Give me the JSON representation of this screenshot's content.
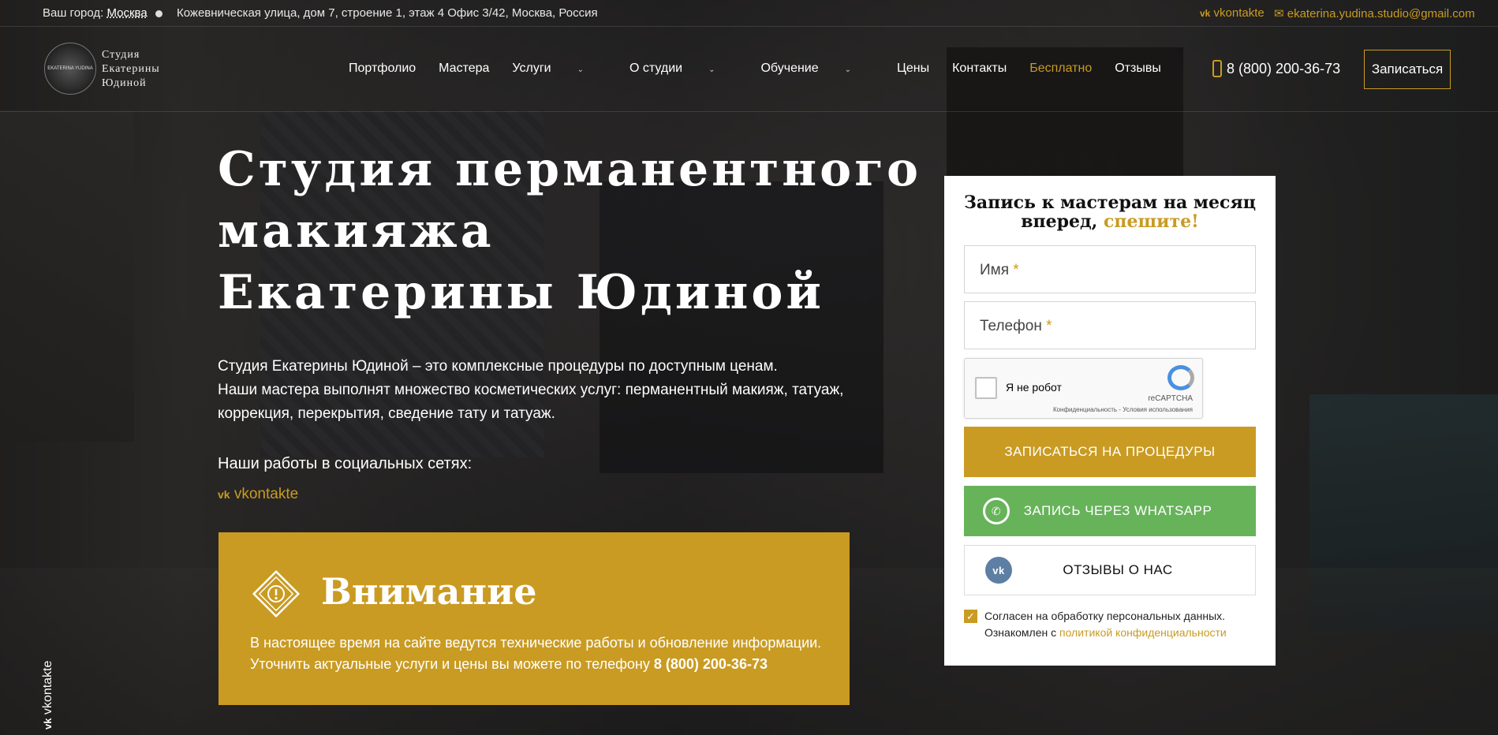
{
  "topbar": {
    "city_label": "Ваш город:",
    "city": "Москва",
    "address": "Кожевническая улица, дом 7, строение 1, этаж 4 Офис 3/42, Москва, Россия",
    "vk": "vkontakte",
    "email": "ekaterina.yudina.studio@gmail.com"
  },
  "header": {
    "logo_line1": "Студия",
    "logo_line2": "Екатерины",
    "logo_line3": "Юдиной",
    "logo_badge": "EKATERINA YUDINA",
    "nav": [
      {
        "label": "Портфолио"
      },
      {
        "label": "Мастера"
      },
      {
        "label": "Услуги"
      },
      {
        "label": "О студии"
      },
      {
        "label": "Обучение"
      },
      {
        "label": "Цены"
      },
      {
        "label": "Контакты"
      },
      {
        "label": "Бесплатно"
      },
      {
        "label": "Отзывы"
      }
    ],
    "phone": "8 (800) 200-36-73",
    "signup": "Записаться"
  },
  "hero": {
    "title_line1": "Студия перманентного",
    "title_line2": "макияжа",
    "title_line3": "Екатерины Юдиной",
    "desc_line1": "Студия Екатерины Юдиной – это комплексные процедуры по доступным ценам.",
    "desc_line2": "Наши мастера выполнят множество косметических услуг: перманентный макияж, татуаж,",
    "desc_line3": "коррекция, перекрытия, сведение тату и татуаж.",
    "social_title": "Наши работы в социальных сетях:",
    "social_vk": "vkontakte"
  },
  "notice": {
    "title": "Внимание",
    "line1": "В настоящее время на сайте ведутся технические работы и обновление информации.",
    "line2": "Уточнить актуальные услуги и цены вы можете по телефону",
    "phone": "8 (800) 200-36-73"
  },
  "form": {
    "title_main": "Запись к мастерам на месяц вперед,",
    "title_accent": "спешите!",
    "name_placeholder": "Имя",
    "phone_placeholder": "Телефон",
    "required_mark": "*",
    "captcha_label": "Я не робот",
    "captcha_brand": "reCAPTCHA",
    "captcha_terms": "Конфиденциальность - Условия использования",
    "btn_procedures": "ЗАПИСАТЬСЯ НА ПРОЦЕДУРЫ",
    "btn_whatsapp": "ЗАПИСЬ ЧЕРЕЗ WHATSAPP",
    "btn_reviews": "ОТЗЫВЫ О НАС",
    "consent_line1": "Согласен на обработку персональных данных.",
    "consent_line2": "Ознакомлен с",
    "consent_link": "политикой конфиденциальности",
    "consent_checked": true
  },
  "side": {
    "vk": "vkontakte"
  },
  "colors": {
    "accent": "#c99b22",
    "whatsapp": "#67b35a",
    "vk": "#5d7fa3"
  }
}
